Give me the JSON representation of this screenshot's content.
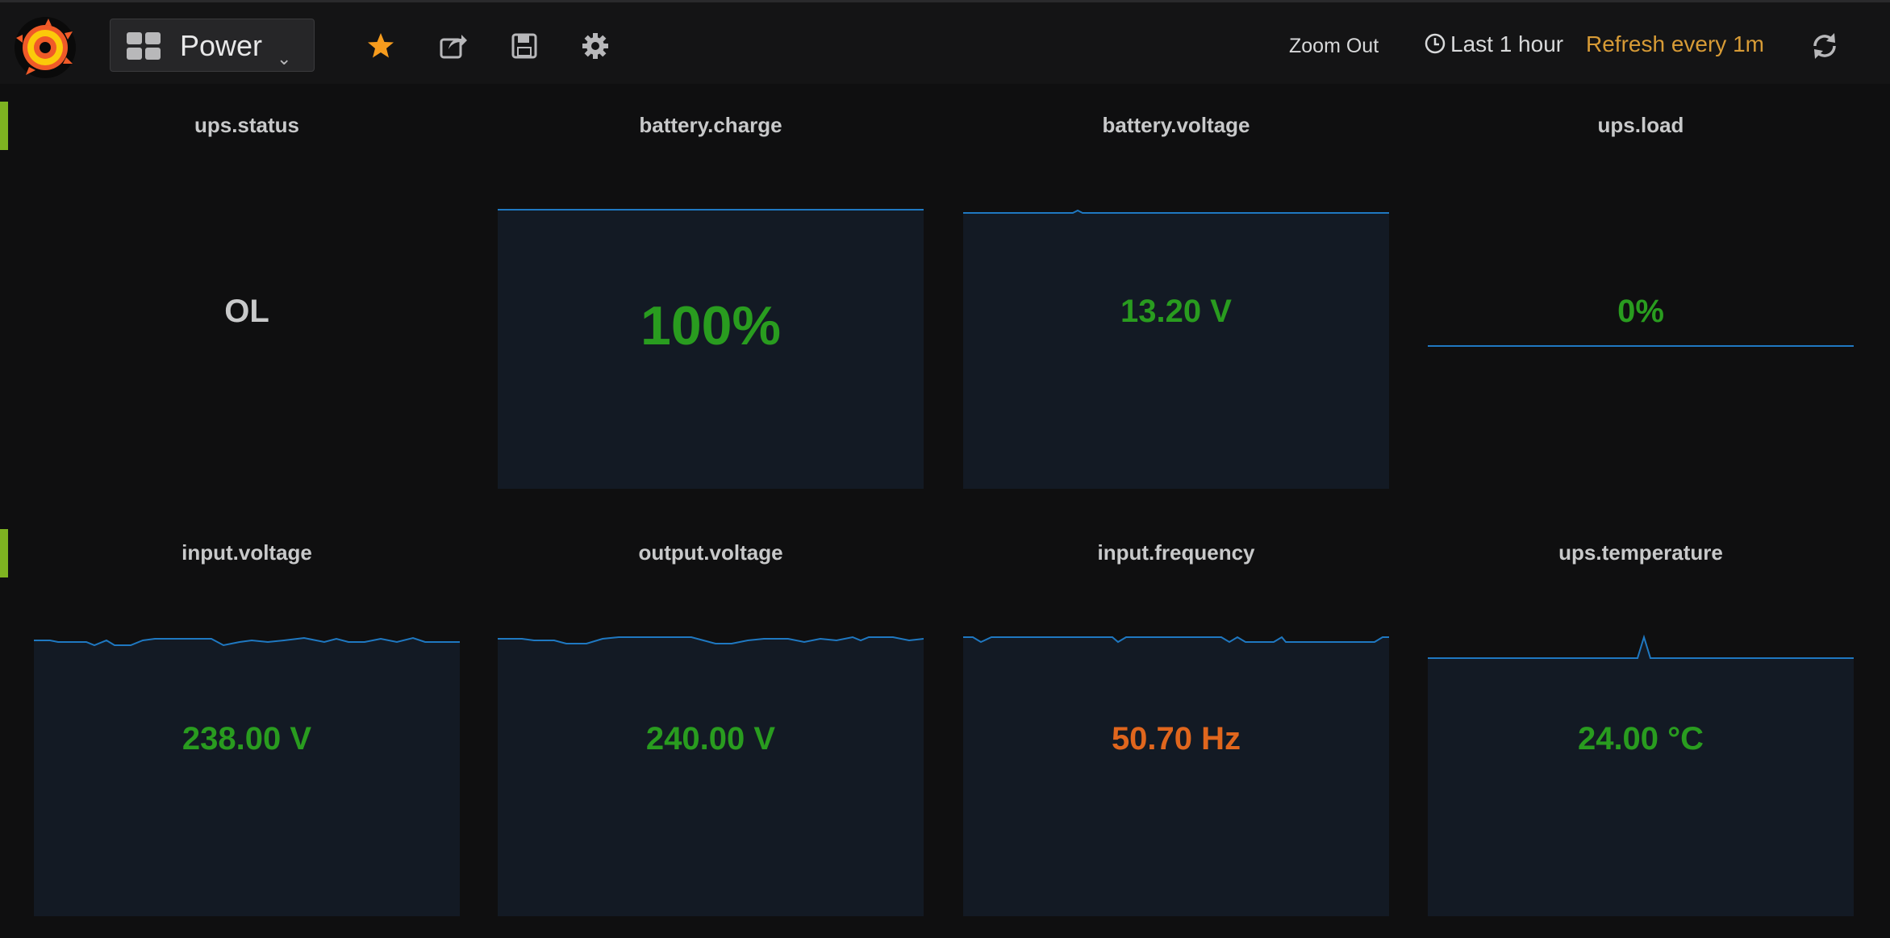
{
  "header": {
    "dashboard_title": "Power",
    "zoom_out_label": "Zoom Out",
    "time_range_label": "Last 1 hour",
    "refresh_label": "Refresh every 1m",
    "colors": {
      "accent_star": "#f79c1d",
      "refresh": "#d79b36"
    }
  },
  "icons": {
    "logo": "grafana-logo",
    "dashboard_picker": "grid-icon",
    "star": "star-icon",
    "share": "share-icon",
    "save": "save-icon",
    "settings": "gear-icon",
    "time": "clock-icon",
    "refresh": "refresh-icon"
  },
  "panels": [
    {
      "title": "ups.status",
      "value": "OL",
      "value_color": "#c8c9ca"
    },
    {
      "title": "battery.charge",
      "value": "100%",
      "value_color": "#299c1f"
    },
    {
      "title": "battery.voltage",
      "value": "13.20 V",
      "value_color": "#299c1f"
    },
    {
      "title": "ups.load",
      "value": "0%",
      "value_color": "#299c1f"
    },
    {
      "title": "input.voltage",
      "value": "238.00 V",
      "value_color": "#299c1f"
    },
    {
      "title": "output.voltage",
      "value": "240.00 V",
      "value_color": "#299c1f"
    },
    {
      "title": "input.frequency",
      "value": "50.70 Hz",
      "value_color": "#e0661d"
    },
    {
      "title": "ups.temperature",
      "value": "24.00 °C",
      "value_color": "#299c1f"
    }
  ],
  "colors": {
    "row_marker": "#7eb321",
    "sparkline": "#1f78c1",
    "spark_fill": "#131a24"
  }
}
